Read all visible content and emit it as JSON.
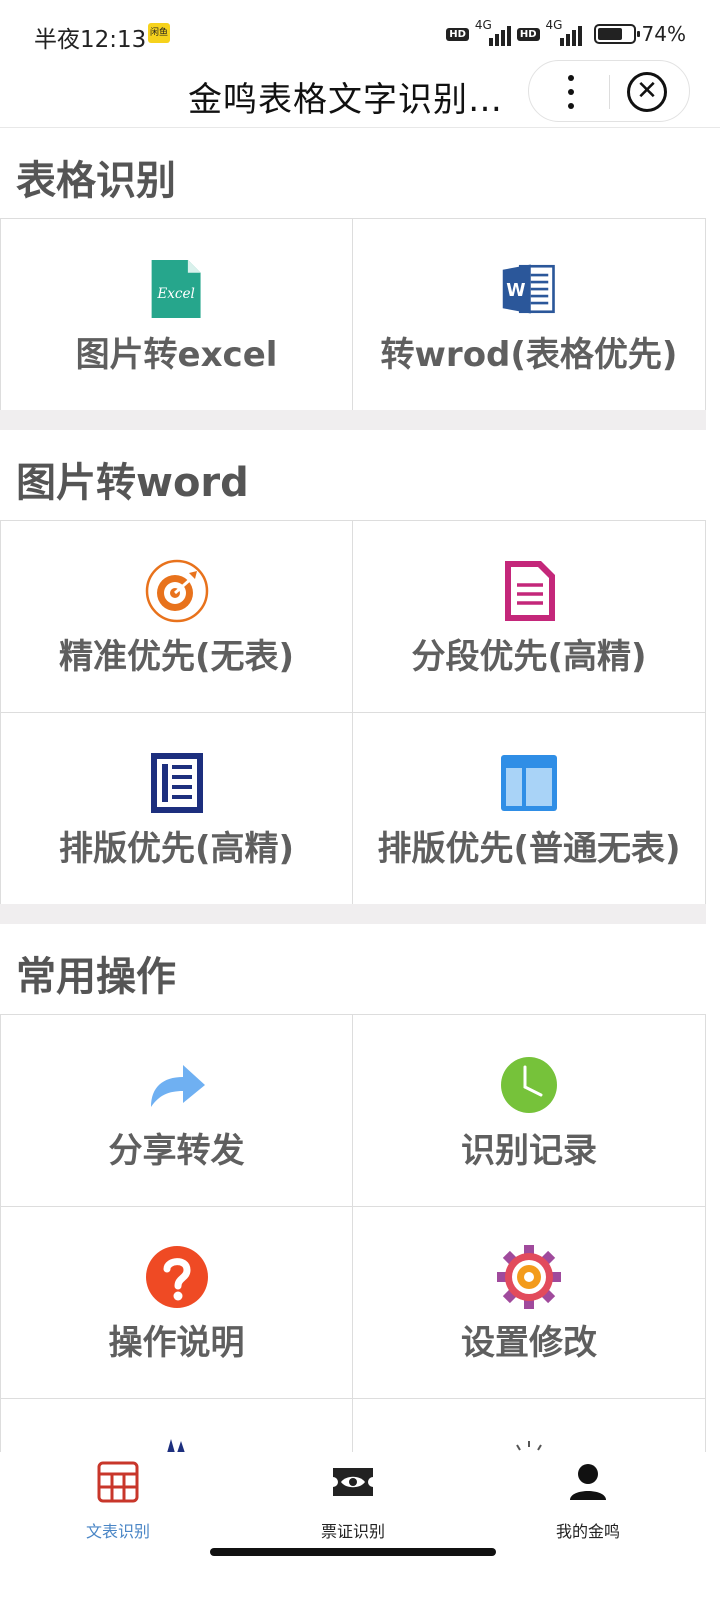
{
  "status_bar": {
    "time": "半夜12:13",
    "notification": "闲鱼",
    "network_1": "4G",
    "network_2": "4G",
    "hd_1": "HD",
    "hd_2": "HD",
    "battery": "74%",
    "battery_level": 0.74
  },
  "title_bar": {
    "title": "金鸣表格文字识别…"
  },
  "sections": {
    "table_recognition": {
      "title": "表格识别",
      "items": [
        {
          "label": "图片转excel",
          "icon": "excel-icon"
        },
        {
          "label": "转wrod(表格优先)",
          "icon": "word-icon"
        }
      ]
    },
    "image_to_word": {
      "title": "图片转word",
      "items": [
        {
          "label": "精准优先(无表)",
          "icon": "target-icon"
        },
        {
          "label": "分段优先(高精)",
          "icon": "document-icon"
        },
        {
          "label": "排版优先(高精)",
          "icon": "layout-list-icon"
        },
        {
          "label": "排版优先(普通无表)",
          "icon": "layout-grid-icon"
        }
      ]
    },
    "common": {
      "title": "常用操作",
      "items": [
        {
          "label": "分享转发",
          "icon": "share-icon"
        },
        {
          "label": "识别记录",
          "icon": "clock-icon"
        },
        {
          "label": "操作说明",
          "icon": "question-icon"
        },
        {
          "label": "设置修改",
          "icon": "settings-gear-icon"
        }
      ]
    }
  },
  "tab_bar": {
    "tabs": [
      {
        "label": "文表识别",
        "icon": "table-grid-icon",
        "active": true
      },
      {
        "label": "票证识别",
        "icon": "ticket-icon",
        "active": false
      },
      {
        "label": "我的金鸣",
        "icon": "user-icon",
        "active": false
      }
    ]
  },
  "colors": {
    "excel_green": "#26a68c",
    "word_blue": "#2b579a",
    "target_orange": "#e8721c",
    "doc_magenta": "#c4277a",
    "layout_navy": "#1d2f7e",
    "layout_blue": "#2f8ee6",
    "share_blue": "#6fb0f2",
    "clock_green": "#76c23a",
    "question_red": "#ef4a24",
    "active_tab": "#4a86c6",
    "tab_icon_red": "#c8362a"
  }
}
